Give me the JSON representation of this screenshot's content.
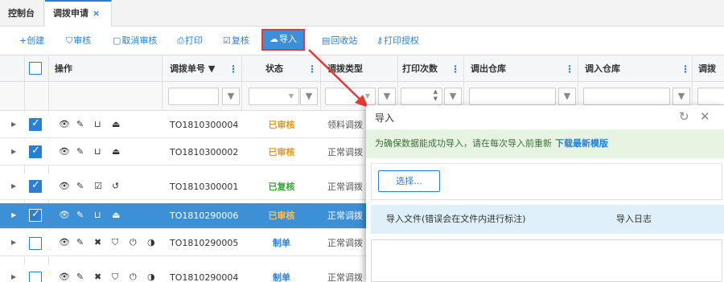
{
  "tabs": [
    {
      "label": "控制台"
    },
    {
      "label": "调拨申请",
      "close": "×"
    }
  ],
  "toolbar": {
    "create": "+创建",
    "approve": "审核",
    "cancel_approve": "取消审核",
    "print": "打印",
    "recheck": "复核",
    "import": "导入",
    "recycle": "回收站",
    "print_auth": "打印授权"
  },
  "table": {
    "headers": {
      "operation": "操作",
      "order_no": "调拨单号 ▼",
      "status": "状态",
      "type": "调拨类型",
      "print_count": "打印次数",
      "out_warehouse": "调出仓库",
      "in_warehouse": "调入仓库",
      "date": "调拨日"
    },
    "rows": [
      {
        "order_no": "TO1810300004",
        "status": "已审核",
        "status_color": "#e39a1c",
        "type": "领料调拨",
        "checked": true,
        "selected": false
      },
      {
        "order_no": "TO1810300002",
        "status": "已审核",
        "status_color": "#e39a1c",
        "type": "正常调拨",
        "checked": true,
        "selected": false
      },
      {
        "order_no": "TO1810300001",
        "status": "已复核",
        "status_color": "#3aa33a",
        "type": "正常调拨",
        "checked": true,
        "selected": false
      },
      {
        "order_no": "TO1810290006",
        "status": "已审核",
        "status_color": "#e39a1c",
        "type": "正常调拨",
        "checked": true,
        "selected": true
      },
      {
        "order_no": "TO1810290005",
        "status": "制单",
        "status_color": "#2a7fd4",
        "type": "正常调拨",
        "checked": false,
        "selected": false
      },
      {
        "order_no": "TO1810290004",
        "status": "制单",
        "status_color": "#2a7fd4",
        "type": "正常调拨",
        "checked": false,
        "selected": false
      }
    ]
  },
  "dialog": {
    "title": "导入",
    "info_text": "为确保数据能成功导入，请在每次导入前重新",
    "info_link": "下载最新模版",
    "select_button": "选择...",
    "tab_import_file": "导入文件(错误会在文件内进行标注)",
    "tab_import_log": "导入日志"
  },
  "colors": {
    "accent": "#2a7fd4",
    "highlight": "#e53935"
  }
}
